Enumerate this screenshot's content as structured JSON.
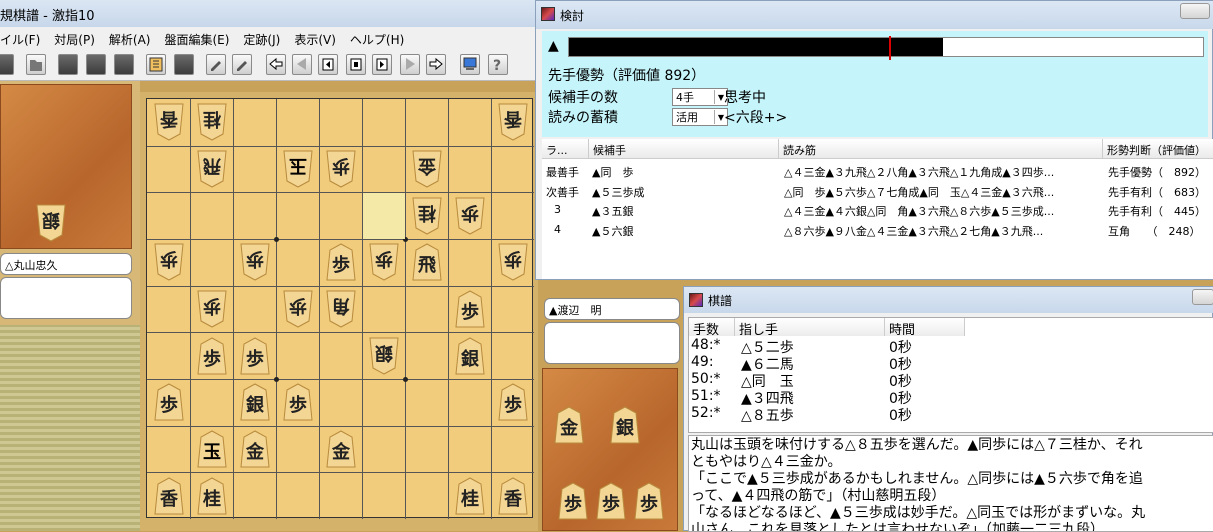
{
  "main": {
    "title": "規棋譜 - 激指10",
    "menu": [
      "イル(F)",
      "対局(P)",
      "解析(A)",
      "盤面編集(E)",
      "定跡(J)",
      "表示(V)",
      "ヘルプ(H)"
    ],
    "gote_player": "△丸山忠久",
    "sente_player": "▲渡辺　明",
    "gote_hand": [
      "銀"
    ],
    "sente_hand": [
      "金",
      "銀",
      "歩",
      "歩",
      "歩"
    ]
  },
  "board": {
    "rows": [
      [
        "v香",
        "v桂",
        "",
        "",
        "",
        "",
        "",
        "",
        "v香"
      ],
      [
        "",
        "v飛",
        "",
        "v玉",
        "v歩",
        "",
        "v金",
        "",
        ""
      ],
      [
        "",
        "",
        "",
        "",
        "",
        "",
        "v桂",
        "v歩",
        ""
      ],
      [
        "v歩",
        "",
        "v歩",
        "",
        "歩",
        "v歩",
        "飛",
        "",
        "v歩"
      ],
      [
        "",
        "v歩",
        "",
        "v歩",
        "v角",
        "",
        "",
        "歩",
        ""
      ],
      [
        "",
        "歩",
        "歩",
        "",
        "",
        "v銀",
        "",
        "銀",
        ""
      ],
      [
        "歩",
        "",
        "銀",
        "歩",
        "",
        "",
        "",
        "",
        "歩"
      ],
      [
        "",
        "玉",
        "金",
        "",
        "金",
        "",
        "",
        "",
        ""
      ],
      [
        "香",
        "桂",
        "",
        "",
        "",
        "",
        "",
        "桂",
        "香"
      ]
    ],
    "last_move_highlight": "5,2"
  },
  "analysis": {
    "title": "検討",
    "gauge_symbol": "▲",
    "gauge_fraction": 0.59,
    "marker_fraction": 0.505,
    "eval_text": "先手優勢（評価値 892）",
    "candidates_label": "候補手の数",
    "candidates_value": "4手",
    "status": "思考中",
    "store_label": "読みの蓄積",
    "store_value": "活用",
    "level": "<六段+>",
    "headers": [
      "ラ...",
      "候補手",
      "読み筋",
      "形勢判断（評価値）"
    ],
    "rows": [
      {
        "rank": "最善手",
        "move": "▲同　歩",
        "line": "△４三金▲３九飛△２八角▲３六飛△１九角成▲３四歩...",
        "eval": "先手優勢（　892）"
      },
      {
        "rank": "次善手",
        "move": "▲５三歩成",
        "line": "△同　歩▲５六歩△７七角成▲同　玉△４三金▲３六飛...",
        "eval": "先手有利（　683）"
      },
      {
        "rank": "3",
        "move": "▲３五銀",
        "line": "△４三金▲４六銀△同　角▲３六飛△８六歩▲５三歩成...",
        "eval": "先手有利（　445）"
      },
      {
        "rank": "4",
        "move": "▲５六銀",
        "line": "△８六歩▲９八金△４三金▲３六飛△２七角▲３九飛...",
        "eval": "互角　　（　248）"
      }
    ]
  },
  "kifu": {
    "title": "棋譜",
    "headers": [
      "手数",
      "指し手",
      "時間"
    ],
    "rows": [
      {
        "num": "48:*",
        "move": "△５二歩",
        "time": "0秒"
      },
      {
        "num": "49:",
        "move": "▲６二馬",
        "time": "0秒"
      },
      {
        "num": "50:*",
        "move": "△同　玉",
        "time": "0秒"
      },
      {
        "num": "51:*",
        "move": "▲３四飛",
        "time": "0秒"
      },
      {
        "num": "52:*",
        "move": "△８五歩",
        "time": "0秒"
      }
    ],
    "comment": [
      "丸山は玉頭を味付けする△８五歩を選んだ。▲同歩には△７三桂か、それ",
      "ともやはり△４三金か。",
      "「ここで▲５三歩成があるかもしれません。△同歩には▲５六歩で角を追",
      "って、▲４四飛の筋で」（村山慈明五段）",
      "「なるほどなるほど、▲５三歩成は妙手だ。△同玉では形がまずいな。丸",
      "山さん、これを見落としたとは言わせないぞ」（加藤一二三九段）"
    ]
  },
  "colors": {
    "gauge": "#000000",
    "marker": "#dd0000",
    "panel": "#c5f4fa"
  }
}
